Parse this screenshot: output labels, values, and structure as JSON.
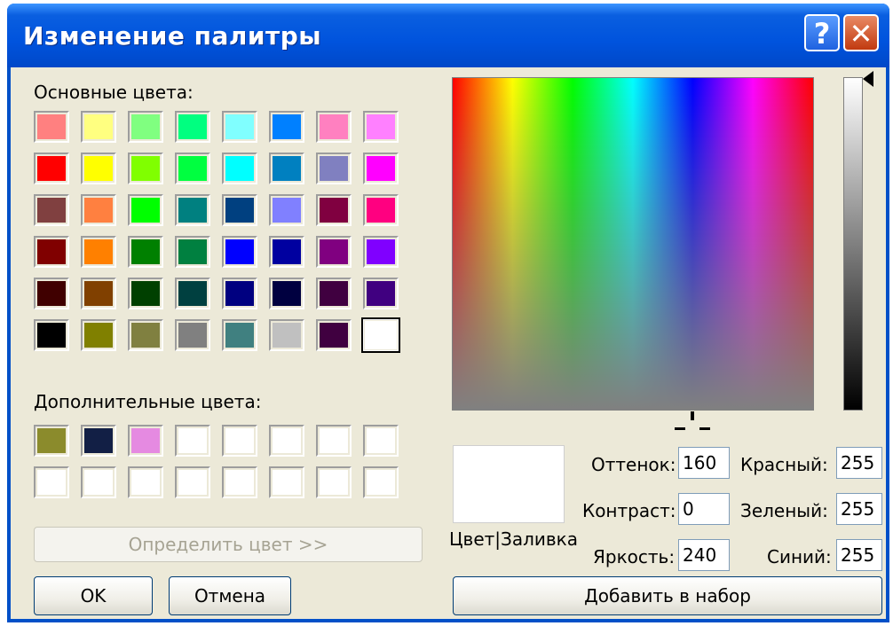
{
  "window": {
    "title": "Изменение палитры"
  },
  "titlebar": {
    "help_label": "?",
    "close_label": "✕"
  },
  "labels": {
    "basic_colors": "Основные цвета:",
    "custom_colors": "Дополнительные цвета:",
    "color_solid": "Цвет|Заливка",
    "hue": "Оттенок:",
    "sat": "Контраст:",
    "lum": "Яркость:",
    "red": "Красный:",
    "green": "Зеленый:",
    "blue": "Синий:"
  },
  "buttons": {
    "define": "Определить цвет >>",
    "ok": "OK",
    "cancel": "Отмена",
    "add": "Добавить в набор"
  },
  "values": {
    "hue": "160",
    "sat": "0",
    "lum": "240",
    "red": "255",
    "green": "255",
    "blue": "255"
  },
  "basic_colors": [
    [
      "#ff8080",
      "#ffff80",
      "#80ff80",
      "#00ff80",
      "#80ffff",
      "#0080ff",
      "#ff80c0",
      "#ff80ff"
    ],
    [
      "#ff0000",
      "#ffff00",
      "#80ff00",
      "#00ff40",
      "#00ffff",
      "#0080c0",
      "#8080c0",
      "#ff00ff"
    ],
    [
      "#804040",
      "#ff8040",
      "#00ff00",
      "#008080",
      "#004080",
      "#8080ff",
      "#800040",
      "#ff0080"
    ],
    [
      "#800000",
      "#ff8000",
      "#008000",
      "#008040",
      "#0000ff",
      "#0000a0",
      "#800080",
      "#8000ff"
    ],
    [
      "#400000",
      "#804000",
      "#004000",
      "#004040",
      "#000080",
      "#000040",
      "#400040",
      "#400080"
    ],
    [
      "#000000",
      "#808000",
      "#808040",
      "#808080",
      "#408080",
      "#c0c0c0",
      "#400040",
      "#ffffff"
    ]
  ],
  "selected_basic": "#ffffff",
  "custom_colors": [
    [
      "#8b8b2c",
      "#121f45",
      "#e58ae1",
      "#ffffff",
      "#ffffff",
      "#ffffff",
      "#ffffff",
      "#ffffff"
    ],
    [
      "#ffffff",
      "#ffffff",
      "#ffffff",
      "#ffffff",
      "#ffffff",
      "#ffffff",
      "#ffffff",
      "#ffffff"
    ]
  ]
}
